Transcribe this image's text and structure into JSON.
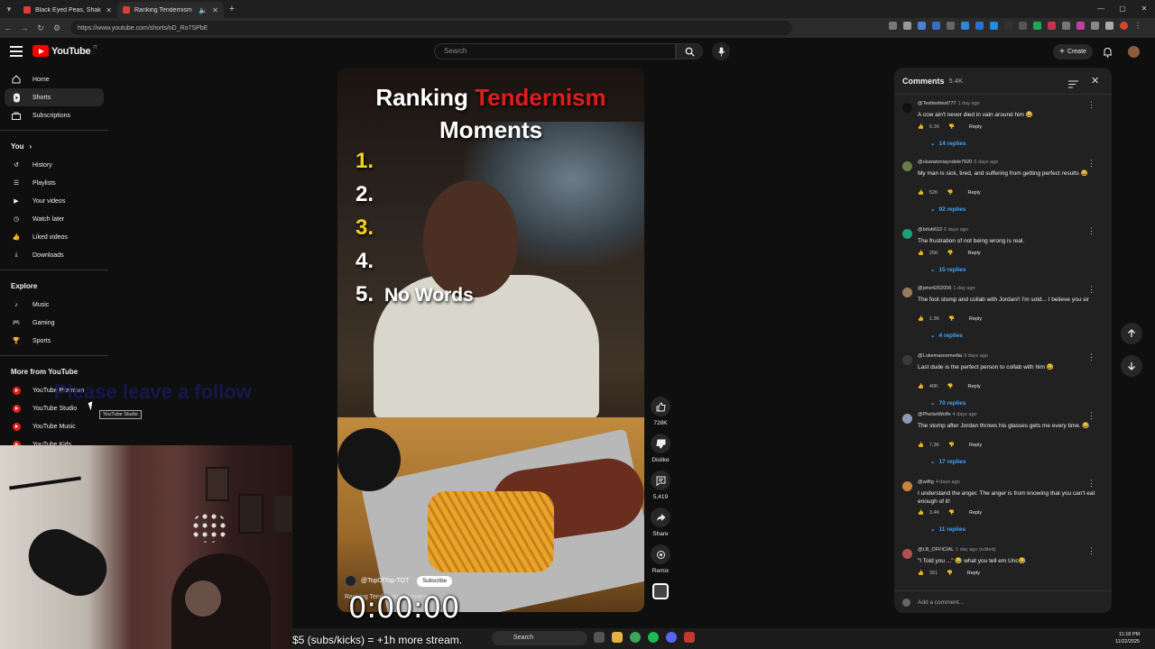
{
  "browser": {
    "tabs": [
      {
        "title": "Black Eyed Peas, Shakira - GIRL",
        "active": false
      },
      {
        "title": "Ranking Tendernism Mome",
        "active": true
      }
    ],
    "url": "https://www.youtube.com/shorts/oD_Ro7SPbE"
  },
  "header": {
    "logo": "YouTube",
    "logo_country": "IT",
    "search_placeholder": "Search",
    "create_label": "Create"
  },
  "sidebar": {
    "primary": [
      {
        "label": "Home",
        "icon": "home-icon",
        "active": false
      },
      {
        "label": "Shorts",
        "icon": "shorts-icon",
        "active": true
      },
      {
        "label": "Subscriptions",
        "icon": "subscriptions-icon",
        "active": false
      }
    ],
    "you_title": "You",
    "you": [
      {
        "label": "History",
        "icon": "history-icon"
      },
      {
        "label": "Playlists",
        "icon": "playlists-icon"
      },
      {
        "label": "Your videos",
        "icon": "your-videos-icon"
      },
      {
        "label": "Watch later",
        "icon": "watch-later-icon"
      },
      {
        "label": "Liked videos",
        "icon": "liked-videos-icon"
      },
      {
        "label": "Downloads",
        "icon": "downloads-icon"
      }
    ],
    "explore_title": "Explore",
    "explore": [
      {
        "label": "Music",
        "icon": "music-icon"
      },
      {
        "label": "Gaming",
        "icon": "gaming-icon"
      },
      {
        "label": "Sports",
        "icon": "sports-icon"
      }
    ],
    "more_title": "More from YouTube",
    "more": [
      {
        "label": "YouTube Premium"
      },
      {
        "label": "YouTube Studio"
      },
      {
        "label": "YouTube Music"
      },
      {
        "label": "YouTube Kids"
      }
    ],
    "tooltip": "YouTube Studio"
  },
  "overlay": {
    "follow_text": "Please leave a follow",
    "timer": "0:00:00",
    "promo": "$5 (subs/kicks) = +1h more stream."
  },
  "video": {
    "title_a": "Ranking",
    "title_b": "Tendernism",
    "title_c": "Moments",
    "ranks": [
      "1.",
      "2.",
      "3.",
      "4.",
      "5."
    ],
    "rank5_text": "No Words",
    "channel": "@TopOfTop-TOT",
    "subscribe": "Subscribe",
    "caption": "Ranking Tendernism Moments"
  },
  "actions": {
    "like_count": "728K",
    "dislike": "Dislike",
    "comments_count": "5,419",
    "share": "Share",
    "remix": "Remix"
  },
  "comments": {
    "title": "Comments",
    "count": "5.4K",
    "reply_label": "Reply",
    "add_placeholder": "Add a comment...",
    "items": [
      {
        "user": "@Testtesttest777",
        "when": "1 day ago",
        "text": "A cow ain't never died in vain around him 😂",
        "likes": "6.1K",
        "replies": "14 replies",
        "color": "#111111"
      },
      {
        "user": "@oluwatoniayodele7920",
        "when": "6 days ago",
        "text": "My man is sick, tired, and suffering from getting perfect results 😂",
        "likes": "52K",
        "replies": "92 replies",
        "color": "#6b7a4a"
      },
      {
        "user": "@bdub613",
        "when": "6 days ago",
        "text": "The frustration of not being wrong is real.",
        "likes": "25K",
        "replies": "15 replies",
        "color": "#1e9e7a"
      },
      {
        "user": "@pino4202006",
        "when": "1 day ago",
        "text": "The foot stomp and collab with Jordan!! I'm sold... I believe you sir",
        "likes": "1.3K",
        "replies": "4 replies",
        "color": "#9a7a5a"
      },
      {
        "user": "@Lukemasonmedia",
        "when": "9 days ago",
        "text": "Last dude is the perfect person to collab with him 😂",
        "likes": "40K",
        "replies": "70 replies",
        "color": "#3a3a3a"
      },
      {
        "user": "@PhelanWolfe",
        "when": "4 days ago",
        "text": "The stomp after Jordan throws his glasses gets me every time. 😂",
        "likes": "7.3K",
        "replies": "17 replies",
        "color": "#8a9ab8"
      },
      {
        "user": "@wilfig",
        "when": "4 days ago",
        "text": "I understand the anger.  The anger is from knowing that you can't eat enough of it!",
        "likes": "3.4K",
        "replies": "11 replies",
        "color": "#c9863a"
      },
      {
        "user": "@LB_OFFICIAL",
        "when": "1 day ago (edited)",
        "text": "\"I Told you ...\" 😂 what you tell em Unc😂",
        "likes": "391",
        "replies": "",
        "color": "#b05050"
      }
    ]
  },
  "taskbar": {
    "search": "Search",
    "time": "11:18 PM",
    "date": "11/22/2025"
  },
  "colors": {
    "accent_red": "#ff0000",
    "link_blue": "#3ea6ff",
    "title_red": "#e01b1b",
    "rank_yellow": "#f2d21a"
  }
}
